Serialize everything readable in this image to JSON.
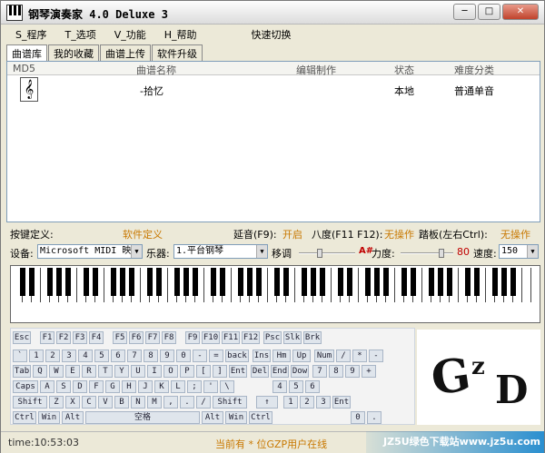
{
  "window": {
    "title": "钢琴演奏家 4.0 Deluxe 3",
    "minimize_glyph": "─",
    "maximize_glyph": "□",
    "close_glyph": "✕"
  },
  "menu": {
    "items": [
      "S_程序",
      "T_选项",
      "V_功能",
      "H_帮助",
      "快速切换"
    ]
  },
  "tabs": [
    "曲谱库",
    "我的收藏",
    "曲谱上传",
    "软件升级"
  ],
  "library": {
    "columns": [
      "MD5",
      "曲谱名称",
      "编辑制作",
      "状态",
      "难度分类"
    ],
    "rows": [
      {
        "md5_icon": "music-file-icon",
        "name": "-拾忆",
        "author": "",
        "status": "本地",
        "difficulty": "普通单音"
      }
    ]
  },
  "info": {
    "key_def_label": "按键定义:",
    "soft_def": "软件定义",
    "sustain_label": "延音(F9):",
    "sustain_value": "开启",
    "octave_label": "八度(F11 F12):",
    "octave_value": "无操作",
    "pedal_label": "踏板(左右Ctrl):",
    "pedal_value": "无操作"
  },
  "controls": {
    "device_label": "设备:",
    "device_value": "Microsoft MIDI 映",
    "instrument_label": "乐器:",
    "instrument_value": "1.平台钢琴",
    "transpose_label": "移调",
    "transpose_value": "A#",
    "velocity_label": "力度:",
    "velocity_value": "80",
    "speed_label": "速度:",
    "speed_value": "150",
    "transpose_level": 0.35,
    "velocity_level": 0.8
  },
  "keyboard": {
    "row1": [
      "Esc",
      "F1",
      "F2",
      "F3",
      "F4",
      "F5",
      "F6",
      "F7",
      "F8",
      "F9",
      "F10",
      "F11",
      "F12",
      "Psc",
      "Slk",
      "Brk"
    ],
    "row2": [
      "`",
      "1",
      "2",
      "3",
      "4",
      "5",
      "6",
      "7",
      "8",
      "9",
      "0",
      "-",
      "=",
      "back",
      "Ins",
      "Hm",
      "Up",
      "Num",
      "/",
      "*",
      "-"
    ],
    "row3": [
      "Tab",
      "Q",
      "W",
      "E",
      "R",
      "T",
      "Y",
      "U",
      "I",
      "O",
      "P",
      "[",
      "]",
      "Ent",
      "Del",
      "End",
      "Dow",
      "7",
      "8",
      "9",
      "+"
    ],
    "row4": [
      "Caps",
      "A",
      "S",
      "D",
      "F",
      "G",
      "H",
      "J",
      "K",
      "L",
      ";",
      "'",
      "\\",
      "4",
      "5",
      "6"
    ],
    "row5": [
      "Shift",
      "Z",
      "X",
      "C",
      "V",
      "B",
      "N",
      "M",
      ",",
      ".",
      "/",
      "Shift",
      "↑",
      "1",
      "2",
      "3",
      "Ent"
    ],
    "row6": [
      "Ctrl",
      "Win",
      "Alt",
      "空格",
      "Alt",
      "Win",
      "Ctrl",
      "0",
      "."
    ]
  },
  "logo_text": {
    "g": "G",
    "z": "z",
    "d": "D"
  },
  "status": {
    "time": "time:10:53:03",
    "online": "当前有 * 位GZP用户在线",
    "watermark": "JZ5U绿色下载站www.jz5u.com"
  }
}
